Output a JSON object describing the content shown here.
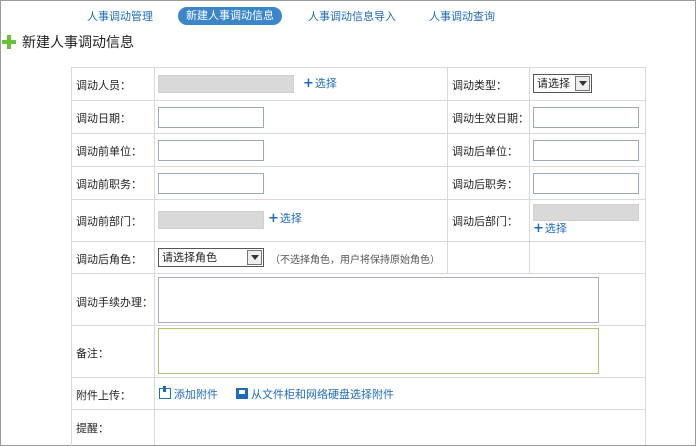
{
  "tabs": [
    {
      "label": "人事调动管理"
    },
    {
      "label": "新建人事调动信息"
    },
    {
      "label": "人事调动信息导入"
    },
    {
      "label": "人事调动查询"
    }
  ],
  "active_tab": "新建人事调动信息",
  "page_title": "新建人事调动信息",
  "form": {
    "employee_label": "调动人员：",
    "select_link": "选择",
    "transfer_type_label": "调动类型：",
    "transfer_type_value": "请选择",
    "date_label": "调动日期：",
    "effective_date_label": "调动生效日期：",
    "unit_before_label": "调动前单位：",
    "unit_after_label": "调动后单位：",
    "position_before_label": "调动前职务：",
    "position_after_label": "调动后职务：",
    "dept_before_label": "调动前部门：",
    "dept_after_label": "调动后部门：",
    "role_after_label": "调动后角色：",
    "role_select_value": "请选择角色",
    "role_hint": "（不选择角色，用户将保持原始角色）",
    "procedure_label": "调动手续办理：",
    "remark_label": "备注：",
    "attachment_label": "附件上传：",
    "add_attachment": "添加附件",
    "select_from_disk": "从文件柜和网络硬盘选择附件",
    "reminder_label": "提醒："
  },
  "colors": {
    "accent": "#1e6bb8",
    "active_tab_bg": "#3a86c8",
    "title_plus": "#6cbf3a"
  }
}
